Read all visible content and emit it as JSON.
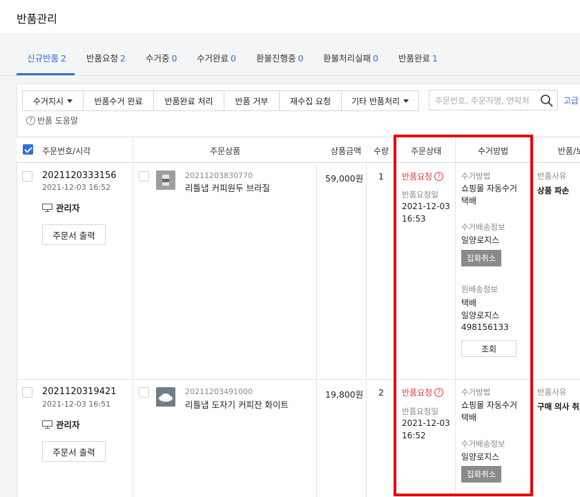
{
  "page": {
    "title": "반품관리"
  },
  "tabs": [
    {
      "label": "신규반품",
      "count": "2"
    },
    {
      "label": "반품요청",
      "count": "2"
    },
    {
      "label": "수거중",
      "count": "0"
    },
    {
      "label": "수거완료",
      "count": "0"
    },
    {
      "label": "환불진행중",
      "count": "0"
    },
    {
      "label": "환불처리실패",
      "count": "0"
    },
    {
      "label": "반품완료",
      "count": "1"
    }
  ],
  "toolbar": {
    "pickup_instruction": "수거지시",
    "return_pickup_complete": "반품수거 완료",
    "return_complete_process": "반품완료 처리",
    "return_reject": "반품 거부",
    "recollect_request": "재수집 요청",
    "other_return_process": "기타 반품처리",
    "search_placeholder": "주문번호, 주문자명, 연락처",
    "advanced": "고급",
    "help": "반품 도움말"
  },
  "table": {
    "headers": {
      "order": "주문번호/시각",
      "product": "주문상품",
      "amount": "상품금액",
      "qty": "수량",
      "status": "주문상태",
      "method": "수거방법",
      "reason": "반품/보"
    },
    "rows": [
      {
        "order_no": "2021120333156",
        "order_time": "2021-12-03 16:52",
        "admin": "관리자",
        "print_btn": "주문서 출력",
        "product_code": "20211203830770",
        "product_name": "리틀냅 커피원두 브라질",
        "amount": "59,000원",
        "qty": "1",
        "status": "반품요청",
        "req_label": "반품요청일",
        "req_date": "2021-12-03",
        "req_time": "16:53",
        "method_label": "수거방법",
        "method_line1": "쇼핑몰 자동수거",
        "method_line2": "택배",
        "ship_label": "수거배송정보",
        "ship_company": "일양로지스",
        "cancel_btn": "집화취소",
        "orig_label": "원배송정보",
        "orig_type": "택배",
        "orig_company": "일양로지스",
        "orig_tracking": "498156133",
        "lookup_btn": "조회",
        "reason_label": "반품사유",
        "reason_value": "상품 파손"
      },
      {
        "order_no": "2021120319421",
        "order_time": "2021-12-03 16:51",
        "admin": "관리자",
        "print_btn": "주문서 출력",
        "product_code": "20211203491000",
        "product_name": "리틀냅 도자기 커피잔 화이트",
        "amount": "19,800원",
        "qty": "2",
        "status": "반품요청",
        "req_label": "반품요청일",
        "req_date": "2021-12-03",
        "req_time": "16:52",
        "method_label": "수거방법",
        "method_line1": "쇼핑몰 자동수거",
        "method_line2": "택배",
        "ship_label": "수거배송정보",
        "ship_company": "일양로지스",
        "cancel_btn": "집화취소",
        "reason_label": "반품사유",
        "reason_value": "구매 의사 취소"
      }
    ]
  },
  "colors": {
    "accent": "#2d6fe0",
    "status_red": "#e03a3a",
    "highlight_box": "#e8000b"
  }
}
